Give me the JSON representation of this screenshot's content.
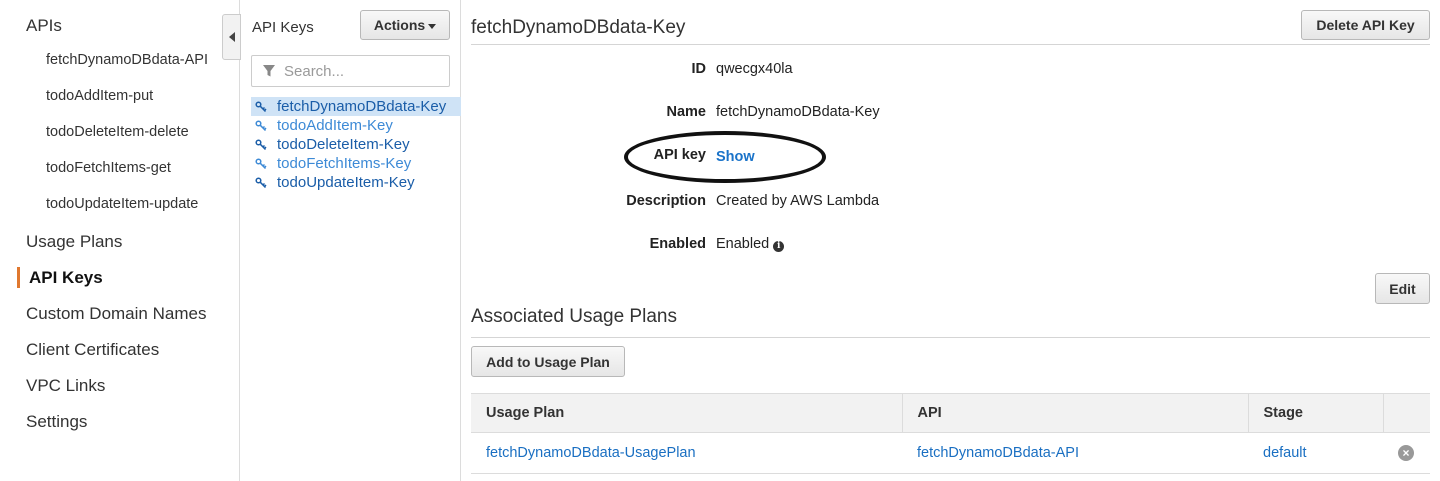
{
  "sidebar": {
    "apis_label": "APIs",
    "api_items": [
      "fetchDynamoDBdata-API",
      "todoAddItem-put",
      "todoDeleteItem-delete",
      "todoFetchItems-get",
      "todoUpdateItem-update"
    ],
    "usage_plans": "Usage Plans",
    "api_keys": "API Keys",
    "custom_domain_names": "Custom Domain Names",
    "client_certificates": "Client Certificates",
    "vpc_links": "VPC Links",
    "settings": "Settings",
    "accent_color": "#e0782f"
  },
  "keys_panel": {
    "title": "API Keys",
    "actions_label": "Actions",
    "search_placeholder": "Search...",
    "keys": [
      "fetchDynamoDBdata-Key",
      "todoAddItem-Key",
      "todoDeleteItem-Key",
      "todoFetchItems-Key",
      "todoUpdateItem-Key"
    ],
    "selected_key": "fetchDynamoDBdata-Key"
  },
  "detail": {
    "title": "fetchDynamoDBdata-Key",
    "delete_label": "Delete API Key",
    "fields": {
      "id_label": "ID",
      "id_value": "qwecgx40la",
      "name_label": "Name",
      "name_value": "fetchDynamoDBdata-Key",
      "api_key_label": "API key",
      "api_key_value": "Show",
      "description_label": "Description",
      "description_value": "Created by AWS Lambda",
      "enabled_label": "Enabled",
      "enabled_value": "Enabled"
    },
    "edit_label": "Edit"
  },
  "usage_plans": {
    "title": "Associated Usage Plans",
    "add_label": "Add to Usage Plan",
    "headers": [
      "Usage Plan",
      "API",
      "Stage"
    ],
    "rows": [
      {
        "plan": "fetchDynamoDBdata-UsagePlan",
        "api": "fetchDynamoDBdata-API",
        "stage": "default"
      }
    ]
  },
  "link_color": "#1a6fc2"
}
